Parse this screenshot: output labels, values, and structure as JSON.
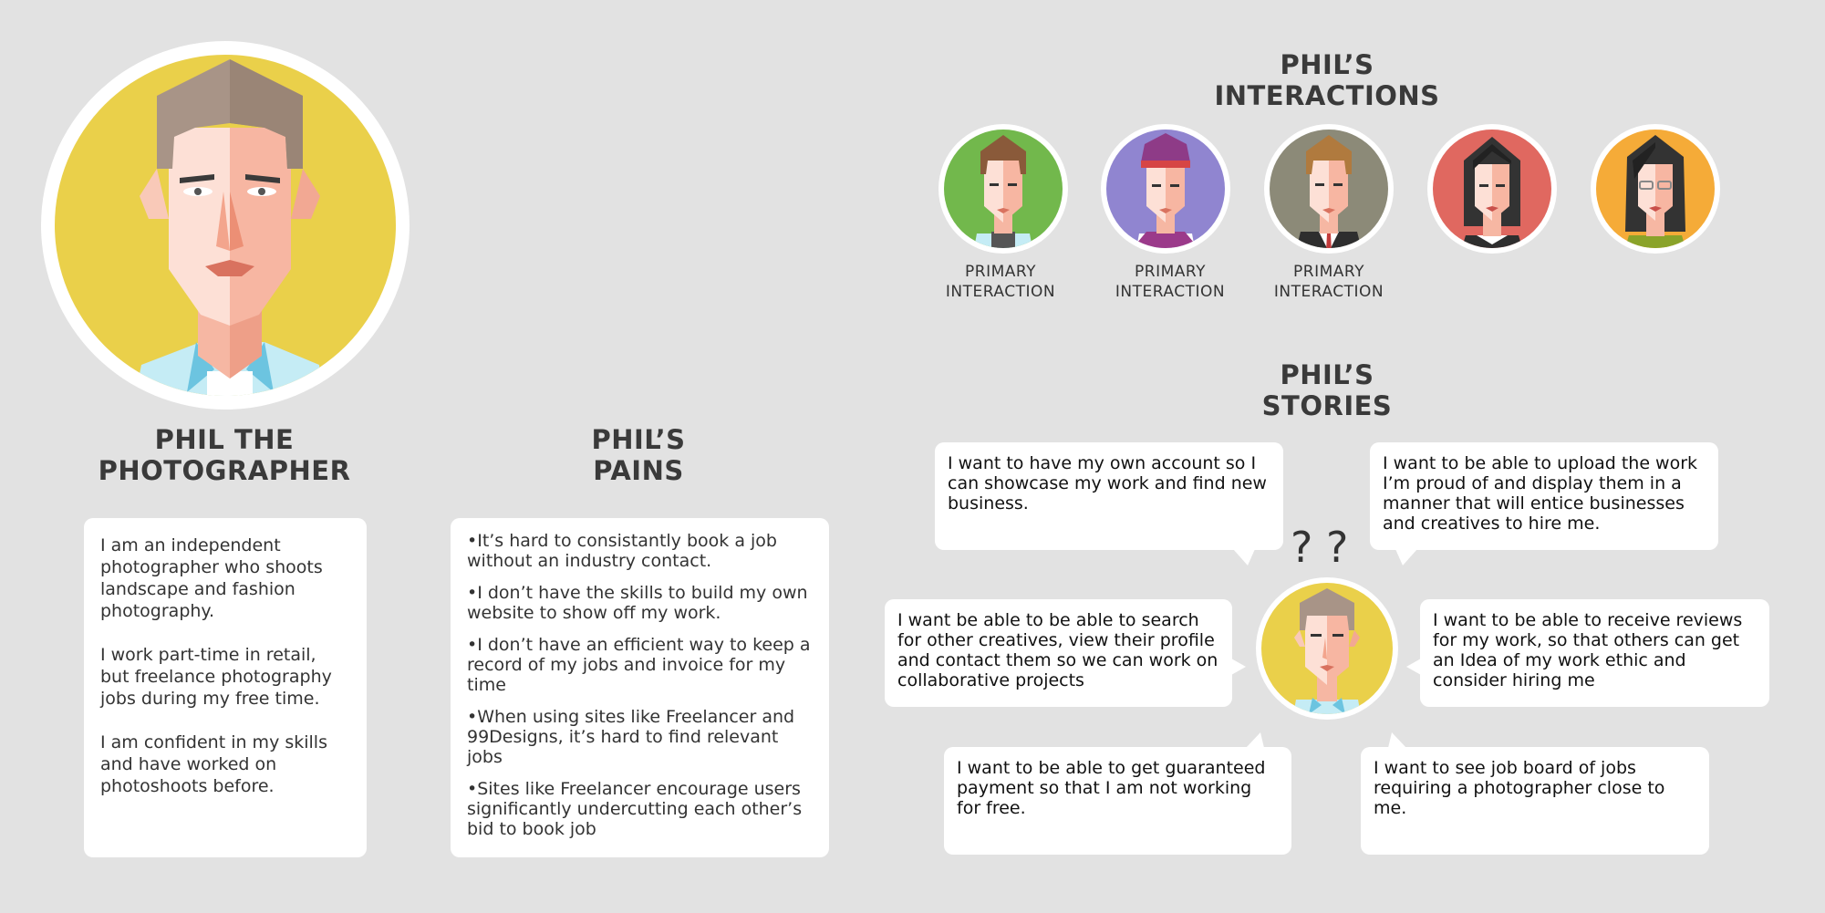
{
  "persona": {
    "name_line1": "PHIL THE",
    "name_line2": "PHOTOGRAPHER",
    "bio": [
      "I am an independent photographer who shoots landscape and fashion photography.",
      "I work part-time in retail, but freelance photography jobs during my free time.",
      "I am confident in my skills and have worked on photoshoots before."
    ],
    "avatar_bg": "#ead04a"
  },
  "pains": {
    "title_line1": "PHIL’S",
    "title_line2": "PAINS",
    "items": [
      "It’s hard to consistantly book a job without an industry contact.",
      "I don’t have the skills to build my own website to show off my work.",
      "I don’t have an efficient way to keep a record of my jobs and invoice for my time",
      "When using sites like Freelancer and 99Designs, it’s hard to find relevant jobs",
      "Sites like Freelancer encourage users significantly undercutting each other’s bid to book job"
    ]
  },
  "interactions": {
    "title_line1": "PHIL’S",
    "title_line2": "INTERACTIONS",
    "people": [
      {
        "bg": "#72b84c",
        "label_line1": "PRIMARY",
        "label_line2": "INTERACTION"
      },
      {
        "bg": "#9085d0",
        "label_line1": "PRIMARY",
        "label_line2": "INTERACTION"
      },
      {
        "bg": "#8c8a78",
        "label_line1": "PRIMARY",
        "label_line2": "INTERACTION"
      },
      {
        "bg": "#e06860",
        "label_line1": "",
        "label_line2": ""
      },
      {
        "bg": "#f5ab38",
        "label_line1": "",
        "label_line2": ""
      }
    ]
  },
  "stories": {
    "title_line1": "PHIL’S",
    "title_line2": "STORIES",
    "question_marks": "? ?",
    "items": [
      "I want to have my own account so I can showcase my work and find new business.",
      "I want to be able to upload the work I’m proud of and display them in a manner that will entice businesses and creatives to hire me.",
      "I want be able to be able to search for other creatives, view their profile and contact them so we can work on collaborative projects",
      "I want to be able to receive reviews for my work, so that others can get an Idea of my work ethic and consider hiring me",
      "I want to be able to get guaranteed payment so that I am not working for free.",
      "I want to see job board of jobs requiring a photographer close to me."
    ]
  }
}
